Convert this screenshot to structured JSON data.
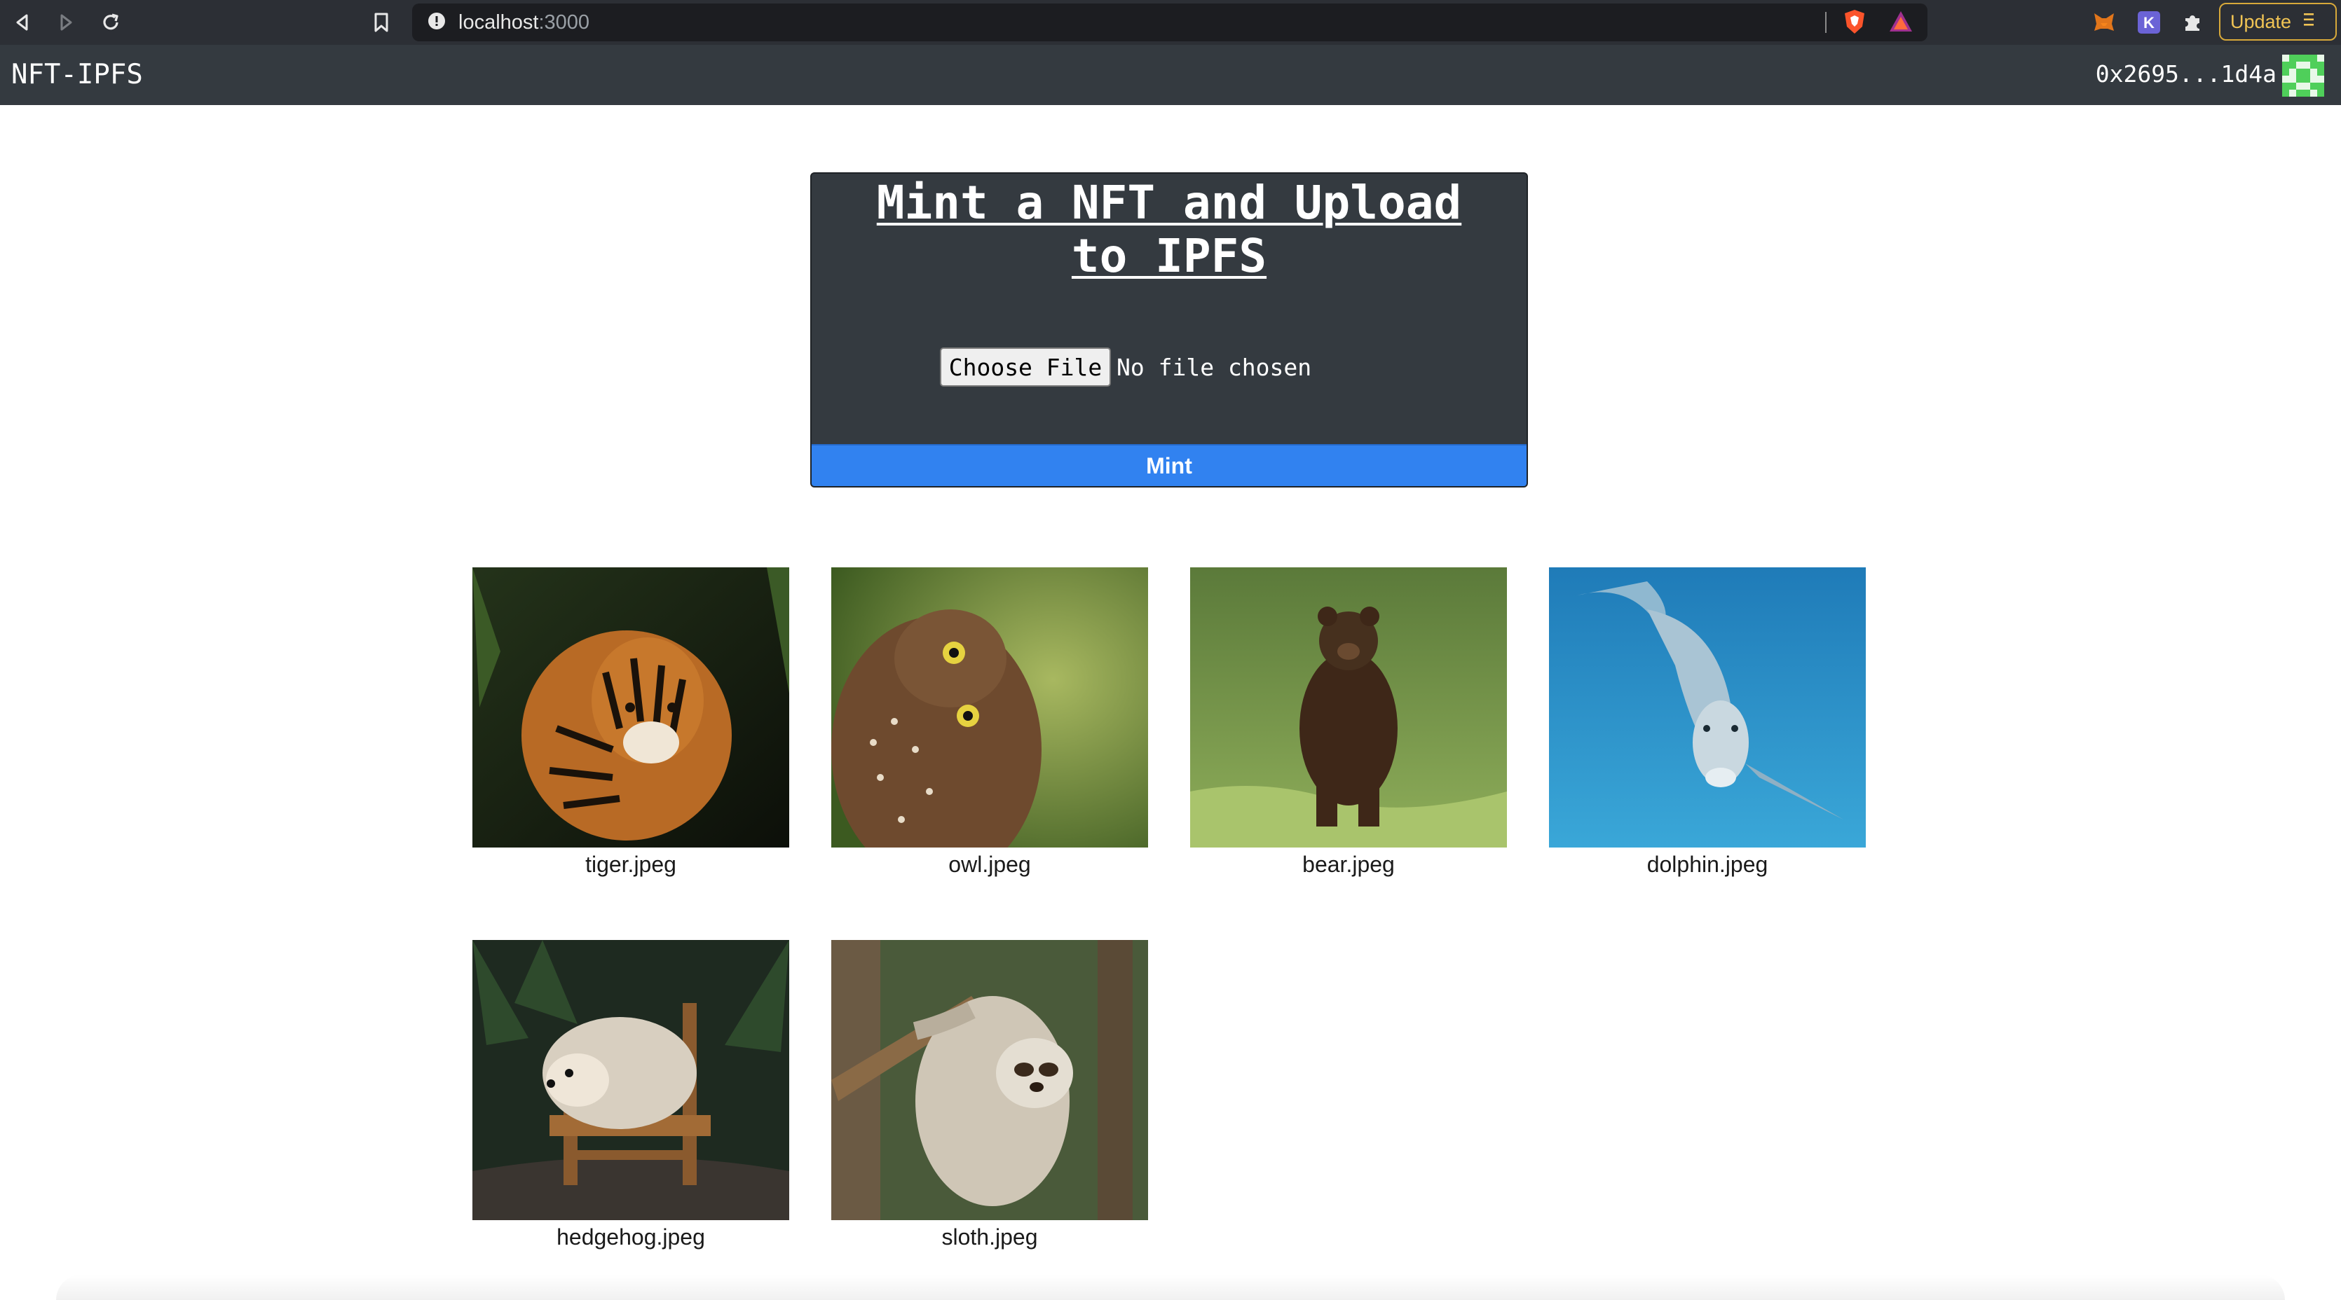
{
  "browser": {
    "url_host": "localhost",
    "url_port": ":3000",
    "update_label": "Update"
  },
  "navbar": {
    "brand": "NFT-IPFS",
    "account": "0x2695...1d4a"
  },
  "mint": {
    "title": "Mint a NFT and Upload to IPFS",
    "choose_file_label": "Choose File",
    "file_status": "No file chosen",
    "submit_label": "Mint"
  },
  "gallery": [
    {
      "name": "tiger.jpeg"
    },
    {
      "name": "owl.jpeg"
    },
    {
      "name": "bear.jpeg"
    },
    {
      "name": "dolphin.jpeg"
    },
    {
      "name": "hedgehog.jpeg"
    },
    {
      "name": "sloth.jpeg"
    }
  ]
}
